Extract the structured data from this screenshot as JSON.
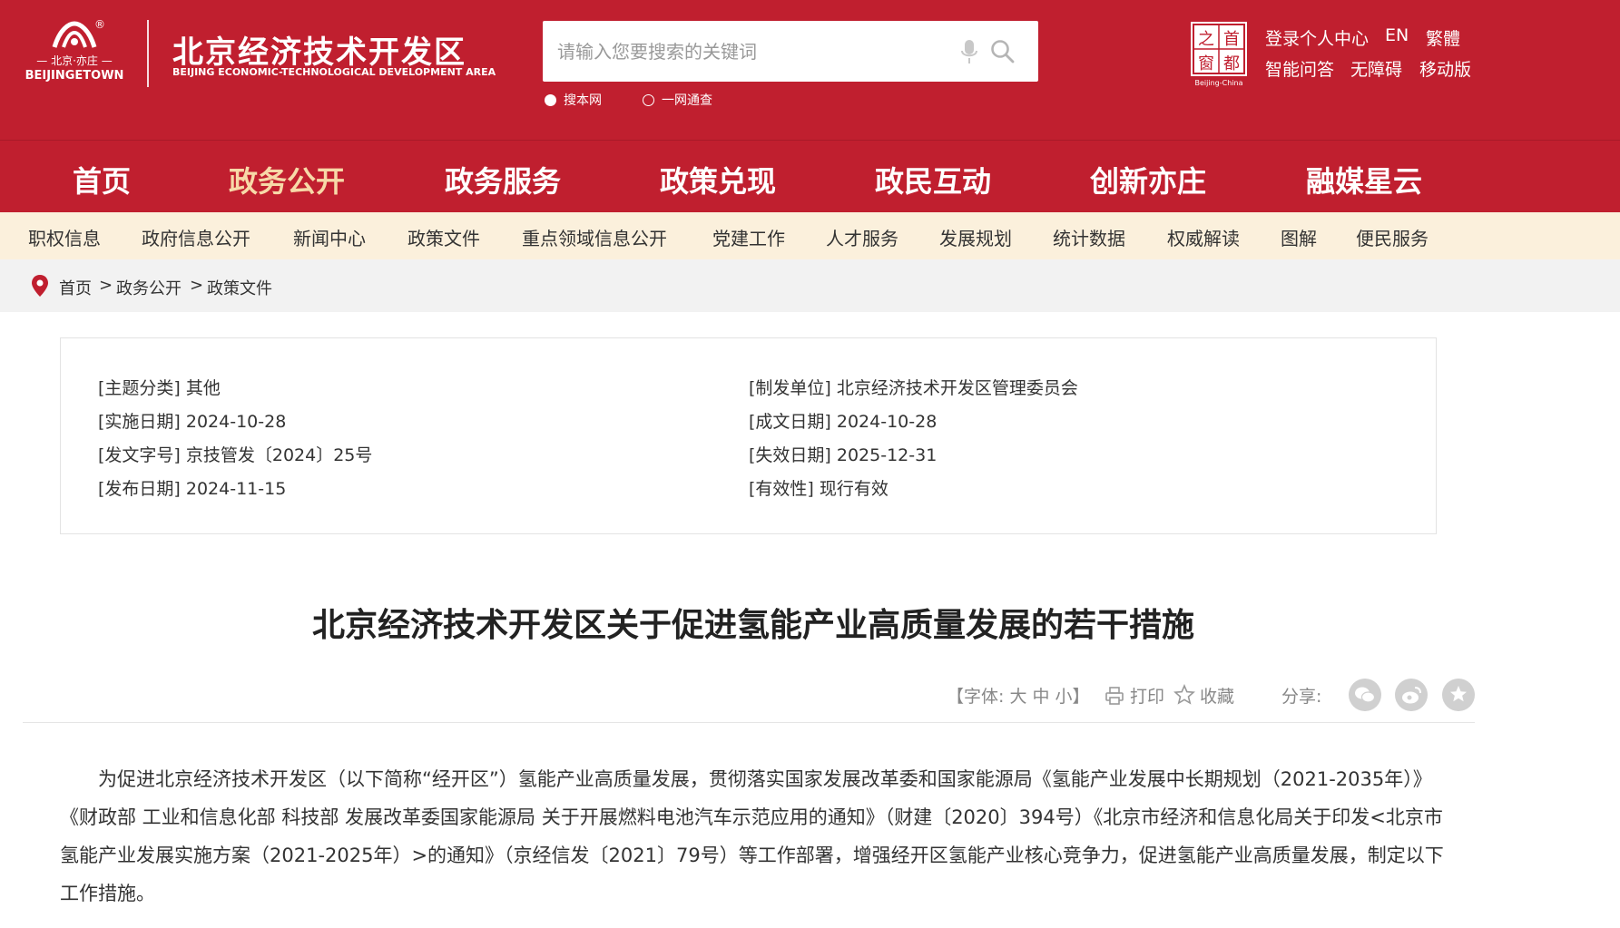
{
  "header": {
    "logo_cn": "北京·亦庄",
    "logo_en": "BEIJINGETOWN",
    "logo_reg": "®",
    "site_title": "北京经济技术开发区",
    "site_subtitle": "BEIJING ECONOMIC-TECHNOLOGICAL DEVELOPMENT AREA",
    "search_placeholder": "请输入您要搜索的关键词",
    "search_options": [
      "搜本网",
      "一网通查"
    ],
    "badge_chars": [
      "首",
      "之",
      "都",
      "窗"
    ],
    "badge_caption": "Beijing-China",
    "top_links_row1": [
      "登录个人中心",
      "EN",
      "繁體"
    ],
    "top_links_row2": [
      "智能问答",
      "无障碍",
      "移动版"
    ],
    "colors": {
      "brand_red": "#c01f2f",
      "active_nav": "#f7d9a8",
      "subnav_bg": "#fbf0dc"
    }
  },
  "main_nav": [
    "首页",
    "政务公开",
    "政务服务",
    "政策兑现",
    "政民互动",
    "创新亦庄",
    "融媒星云"
  ],
  "main_nav_active": "政务公开",
  "sub_nav": [
    "职权信息",
    "政府信息公开",
    "新闻中心",
    "政策文件",
    "重点领域信息公开",
    "党建工作",
    "人才服务",
    "发展规划",
    "统计数据",
    "权威解读",
    "图解",
    "便民服务"
  ],
  "breadcrumb": {
    "items": [
      "首页",
      "政务公开",
      "政策文件"
    ],
    "separator": ">"
  },
  "meta": {
    "left": [
      "[主题分类] 其他",
      "[实施日期] 2024-10-28",
      "[发文字号] 京技管发〔2024〕25号",
      "[发布日期] 2024-11-15"
    ],
    "right": [
      "[制发单位] 北京经济技术开发区管理委员会",
      "[成文日期] 2024-10-28",
      "[失效日期] 2025-12-31",
      "[有效性] 现行有效"
    ]
  },
  "article": {
    "title": "北京经济技术开发区关于促进氢能产业高质量发展的若干措施",
    "font_size_label": "【字体: 大 中 小】",
    "print_label": "打印",
    "favorite_label": "收藏",
    "share_label": "分享:",
    "share_icons": [
      "wechat-icon",
      "weibo-icon",
      "favorite-share-icon"
    ],
    "body": "为促进北京经济技术开发区（以下简称“经开区”）氢能产业高质量发展，贯彻落实国家发展改革委和国家能源局《氢能产业发展中长期规划（2021-2035年）》《财政部 工业和信息化部 科技部 发展改革委国家能源局 关于开展燃料电池汽车示范应用的通知》（财建〔2020〕394号）《北京市经济和信息化局关于印发<北京市氢能产业发展实施方案（2021-2025年）>的通知》（京经信发〔2021〕79号）等工作部署，增强经开区氢能产业核心竞争力，促进氢能产业高质量发展，制定以下工作措施。"
  }
}
